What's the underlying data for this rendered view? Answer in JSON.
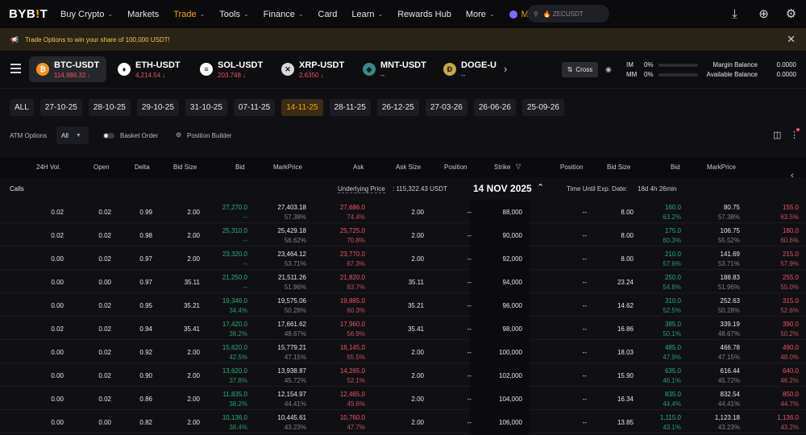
{
  "nav": {
    "logo": "BYB",
    "logo_dot": "!",
    "logo_end": "T",
    "items": [
      {
        "label": "Buy Crypto",
        "chevron": true
      },
      {
        "label": "Markets",
        "chevron": false
      },
      {
        "label": "Trade",
        "chevron": true,
        "active": true
      },
      {
        "label": "Tools",
        "chevron": true
      },
      {
        "label": "Finance",
        "chevron": true
      },
      {
        "label": "Card",
        "chevron": false
      },
      {
        "label": "Learn",
        "chevron": true
      },
      {
        "label": "Rewards Hub",
        "chevron": false
      },
      {
        "label": "More",
        "chevron": true
      }
    ],
    "mnt_label": "MNT",
    "search_placeholder": "ZECUSDT"
  },
  "banner": {
    "text": "Trade Options to win your share of 100,000 USDT!"
  },
  "pairs": [
    {
      "name": "BTC-USDT",
      "price": "114,986.32",
      "arrow": "↓",
      "color": "#f7931a",
      "glyph": "₿"
    },
    {
      "name": "ETH-USDT",
      "price": "4,214.54",
      "arrow": "↓",
      "color": "#ffffff",
      "glyph": "♦"
    },
    {
      "name": "SOL-USDT",
      "price": "203.748",
      "arrow": "↓",
      "color": "#ffffff",
      "glyph": "≡"
    },
    {
      "name": "XRP-USDT",
      "price": "2.6350",
      "arrow": "↓",
      "color": "#d6d8dc",
      "glyph": "✕"
    },
    {
      "name": "MNT-USDT",
      "price": "--",
      "arrow": "",
      "color": "#3a8a8a",
      "glyph": "◆"
    },
    {
      "name": "DOGE-U",
      "price": "--",
      "arrow": "",
      "color": "#c8a84a",
      "glyph": "Ð"
    }
  ],
  "account": {
    "cross_label": "Cross",
    "im_label": "IM",
    "im_value": "0%",
    "mm_label": "MM",
    "mm_value": "0%",
    "margin_balance_label": "Margin Balance",
    "margin_balance": "0.0000",
    "available_balance_label": "Available Balance",
    "available_balance": "0.0000"
  },
  "dates": [
    "ALL",
    "27-10-25",
    "28-10-25",
    "29-10-25",
    "31-10-25",
    "07-11-25",
    "14-11-25",
    "28-11-25",
    "26-12-25",
    "27-03-26",
    "26-06-26",
    "25-09-26"
  ],
  "active_date": "14-11-25",
  "options": {
    "atm_label": "ATM Options",
    "atm_value": "All",
    "basket_label": "Basket Order",
    "builder_label": "Position Builder"
  },
  "headers": {
    "vol": "24H Vol.",
    "open": "Open",
    "delta": "Delta",
    "bid_size": "Bid Size",
    "bid": "Bid",
    "mark": "MarkPrice",
    "ask": "Ask",
    "ask_size": "Ask Size",
    "position": "Position",
    "strike": "Strike",
    "put_position": "Position",
    "put_bid_size": "Bid Size",
    "put_bid": "Bid",
    "put_mark": "MarkPrice"
  },
  "calls_bar": {
    "calls_label": "Calls",
    "underlying_label": "Underlying Price",
    "underlying_value": ": 115,322.43 USDT",
    "expiry": "14 NOV 2025",
    "time_label": "Time Until Exp. Date:",
    "time_value": "18d 4h 26min"
  },
  "rows": [
    {
      "vol": "0.02",
      "open": "0.02",
      "delta": "0.99",
      "bid_size": "2.00",
      "bid": "27,270.0",
      "bid_iv": "--",
      "mark": "27,403.18",
      "mark_iv": "57.38%",
      "ask": "27,686.0",
      "ask_iv": "74.4%",
      "ask_size": "2.00",
      "pos": "--",
      "strike": "88,000",
      "ppos": "--",
      "pbid_size": "8.00",
      "pbid": "160.0",
      "pbid_iv": "63.2%",
      "pmark": "80.75",
      "pmark_iv": "57.38%",
      "pask": "155.0",
      "pask_iv": "63.5%"
    },
    {
      "vol": "0.02",
      "open": "0.02",
      "delta": "0.98",
      "bid_size": "2.00",
      "bid": "25,310.0",
      "bid_iv": "--",
      "mark": "25,429.18",
      "mark_iv": "56.62%",
      "ask": "25,725.0",
      "ask_iv": "70.8%",
      "ask_size": "2.00",
      "pos": "--",
      "strike": "90,000",
      "ppos": "--",
      "pbid_size": "8.00",
      "pbid": "175.0",
      "pbid_iv": "60.3%",
      "pmark": "106.75",
      "pmark_iv": "55.52%",
      "pask": "180.0",
      "pask_iv": "60.6%"
    },
    {
      "vol": "0.00",
      "open": "0.02",
      "delta": "0.97",
      "bid_size": "2.00",
      "bid": "23,320.0",
      "bid_iv": "--",
      "mark": "23,464.12",
      "mark_iv": "53.71%",
      "ask": "23,770.0",
      "ask_iv": "67.3%",
      "ask_size": "2.00",
      "pos": "--",
      "strike": "92,000",
      "ppos": "--",
      "pbid_size": "8.00",
      "pbid": "210.0",
      "pbid_iv": "57.6%",
      "pmark": "141.69",
      "pmark_iv": "53.71%",
      "pask": "215.0",
      "pask_iv": "57.9%"
    },
    {
      "vol": "0.00",
      "open": "0.00",
      "delta": "0.97",
      "bid_size": "35.11",
      "bid": "21,250.0",
      "bid_iv": "--",
      "mark": "21,511.26",
      "mark_iv": "51.96%",
      "ask": "21,820.0",
      "ask_iv": "63.7%",
      "ask_size": "35.11",
      "pos": "--",
      "strike": "94,000",
      "ppos": "--",
      "pbid_size": "23.24",
      "pbid": "250.0",
      "pbid_iv": "54.8%",
      "pmark": "188.83",
      "pmark_iv": "51.96%",
      "pask": "255.0",
      "pask_iv": "55.0%"
    },
    {
      "vol": "0.00",
      "open": "0.02",
      "delta": "0.95",
      "bid_size": "35.21",
      "bid": "19,346.0",
      "bid_iv": "34.4%",
      "mark": "19,575.06",
      "mark_iv": "50.28%",
      "ask": "19,885.0",
      "ask_iv": "60.3%",
      "ask_size": "35.21",
      "pos": "--",
      "strike": "96,000",
      "ppos": "--",
      "pbid_size": "14.62",
      "pbid": "310.0",
      "pbid_iv": "52.5%",
      "pmark": "252.63",
      "pmark_iv": "50.28%",
      "pask": "315.0",
      "pask_iv": "52.6%"
    },
    {
      "vol": "0.02",
      "open": "0.02",
      "delta": "0.94",
      "bid_size": "35.41",
      "bid": "17,420.0",
      "bid_iv": "38.2%",
      "mark": "17,661.62",
      "mark_iv": "48.67%",
      "ask": "17,960.0",
      "ask_iv": "56.9%",
      "ask_size": "35.41",
      "pos": "--",
      "strike": "98,000",
      "ppos": "--",
      "pbid_size": "16.86",
      "pbid": "385.0",
      "pbid_iv": "50.1%",
      "pmark": "339.19",
      "pmark_iv": "48.67%",
      "pask": "390.0",
      "pask_iv": "50.2%"
    },
    {
      "vol": "0.00",
      "open": "0.02",
      "delta": "0.92",
      "bid_size": "2.00",
      "bid": "15,620.0",
      "bid_iv": "42.5%",
      "mark": "15,779.21",
      "mark_iv": "47.15%",
      "ask": "16,145.0",
      "ask_iv": "55.5%",
      "ask_size": "2.00",
      "pos": "--",
      "strike": "100,000",
      "ppos": "--",
      "pbid_size": "18.03",
      "pbid": "485.0",
      "pbid_iv": "47.9%",
      "pmark": "466.78",
      "pmark_iv": "47.15%",
      "pask": "490.0",
      "pask_iv": "48.0%"
    },
    {
      "vol": "0.00",
      "open": "0.02",
      "delta": "0.90",
      "bid_size": "2.00",
      "bid": "13,620.0",
      "bid_iv": "37.8%",
      "mark": "13,938.87",
      "mark_iv": "45.72%",
      "ask": "14,265.0",
      "ask_iv": "52.1%",
      "ask_size": "2.00",
      "pos": "--",
      "strike": "102,000",
      "ppos": "--",
      "pbid_size": "15.90",
      "pbid": "635.0",
      "pbid_iv": "46.1%",
      "pmark": "616.44",
      "pmark_iv": "45.72%",
      "pask": "640.0",
      "pask_iv": "46.2%"
    },
    {
      "vol": "0.00",
      "open": "0.02",
      "delta": "0.86",
      "bid_size": "2.00",
      "bid": "11,835.0",
      "bid_iv": "38.2%",
      "mark": "12,154.97",
      "mark_iv": "44.41%",
      "ask": "12,465.0",
      "ask_iv": "49.6%",
      "ask_size": "2.00",
      "pos": "--",
      "strike": "104,000",
      "ppos": "--",
      "pbid_size": "16.34",
      "pbid": "835.0",
      "pbid_iv": "44.4%",
      "pmark": "832.54",
      "pmark_iv": "44.41%",
      "pask": "850.0",
      "pask_iv": "44.7%"
    },
    {
      "vol": "0.00",
      "open": "0.00",
      "delta": "0.82",
      "bid_size": "2.00",
      "bid": "10,136.0",
      "bid_iv": "38.4%",
      "mark": "10,445.61",
      "mark_iv": "43.23%",
      "ask": "10,760.0",
      "ask_iv": "47.7%",
      "ask_size": "2.00",
      "pos": "--",
      "strike": "106,000",
      "ppos": "--",
      "pbid_size": "13.85",
      "pbid": "1,115.0",
      "pbid_iv": "43.1%",
      "pmark": "1,123.18",
      "pmark_iv": "43.23%",
      "pask": "1,136.0",
      "pask_iv": "43.2%"
    }
  ],
  "colors": {
    "accent": "#f7a600",
    "bid": "#29b275",
    "ask": "#ef5562"
  }
}
